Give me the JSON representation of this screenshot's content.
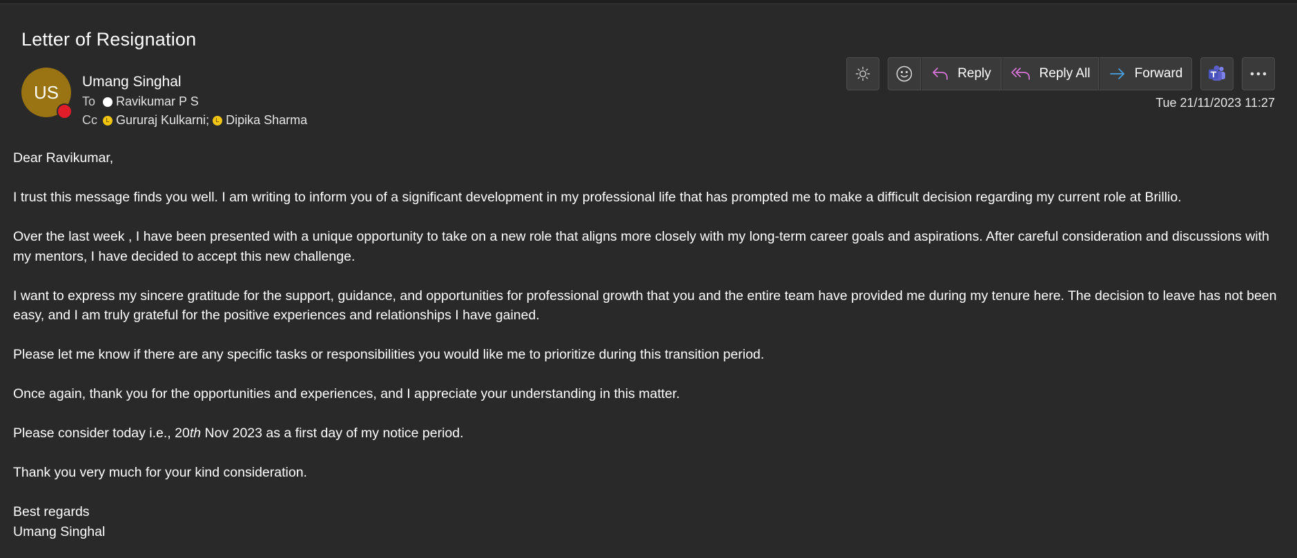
{
  "email": {
    "subject": "Letter of Resignation",
    "sender": {
      "initials": "US",
      "name": "Umang Singhal",
      "presence_color": "#e11d2a",
      "avatar_color": "#9a7412"
    },
    "to_label": "To",
    "to": [
      {
        "name": "Ravikumar P S",
        "status": "white"
      }
    ],
    "cc_label": "Cc",
    "cc": [
      {
        "name": "Gururaj Kulkarni",
        "status": "away"
      },
      {
        "name": "Dipika Sharma",
        "status": "away"
      }
    ],
    "cc_separator": ";",
    "timestamp": "Tue 21/11/2023 11:27"
  },
  "toolbar": {
    "theme_icon": "sun-icon",
    "emoji_icon": "emoji-icon",
    "reply_label": "Reply",
    "reply_all_label": "Reply All",
    "forward_label": "Forward",
    "teams_icon": "teams-icon",
    "more_icon": "more-icon",
    "reply_icon_color": "#d874d8",
    "forward_icon_color": "#4aa3e8",
    "teams_color": "#5b5fc7"
  },
  "body": {
    "greeting": "Dear Ravikumar,",
    "paragraphs": [
      "I trust this message finds you well. I am writing to inform you of a significant development in my professional life that has prompted me to make a difficult decision regarding my current role at Brillio.",
      "Over the last week , I have been presented with a unique opportunity to take on a new role that aligns more closely with my long-term career goals and aspirations. After careful consideration and discussions with my mentors, I have decided to accept this new challenge.",
      "I want to express my sincere gratitude for the support, guidance, and opportunities for professional growth that you and the entire team have provided me during my tenure here. The decision to leave has not been easy, and I am truly grateful for the positive experiences and relationships I have gained.",
      "Please let me know if there are any specific tasks or responsibilities you would like me to prioritize during this transition period.",
      "Once again, thank you for the opportunities and experiences, and I appreciate your understanding in this matter."
    ],
    "notice": {
      "prefix": "Please consider today i.e., 20",
      "suffix_italic": "th",
      "rest": " Nov 2023 as a first day of my notice period."
    },
    "thanks": "Thank you very much for your kind consideration.",
    "signoff": "Best regards",
    "signature": "Umang Singhal"
  }
}
